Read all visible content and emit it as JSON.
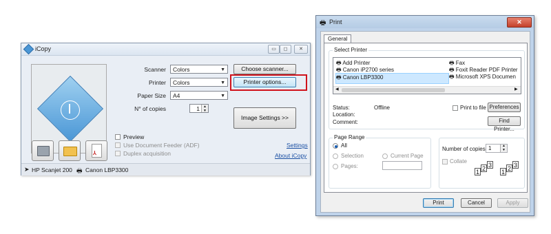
{
  "icopy": {
    "title": "iCopy",
    "window_buttons": {
      "minimize": "▭",
      "maximize": "◻",
      "close": "✕"
    },
    "scanner_label": "Scanner",
    "scanner_value": "Colors",
    "printer_label": "Printer",
    "printer_value": "Colors",
    "paper_size_label": "Paper Size",
    "paper_size_value": "A4",
    "copies_label": "N° of copies",
    "copies_value": "1",
    "choose_scanner_button": "Choose scanner...",
    "printer_options_button": "Printer options...",
    "image_settings_button": "Image Settings >>",
    "preview_label": "Preview",
    "adf_label": "Use Document Feeder (ADF)",
    "duplex_label": "Duplex acquisition",
    "settings_link": "Settings",
    "about_link": "About iCopy",
    "status_scanner": "HP Scanjet 200",
    "status_printer": "Canon LBP3300",
    "colors": {
      "highlight_red": "#d0121b",
      "accent_blue": "#4b97d6"
    }
  },
  "print": {
    "title": "Print",
    "tab": "General",
    "select_printer_title": "Select Printer",
    "printers_left": [
      "Add Printer",
      "Canon iP2700 series",
      "Canon LBP3300"
    ],
    "printers_right": [
      "Fax",
      "Foxit Reader PDF Printer",
      "Microsoft XPS Documen"
    ],
    "selected_printer": "Canon LBP3300",
    "status_label": "Status:",
    "status_value": "Offline",
    "location_label": "Location:",
    "comment_label": "Comment:",
    "print_to_file_label": "Print to file",
    "preferences_button": "Preferences",
    "find_printer_button": "Find Printer...",
    "page_range_title": "Page Range",
    "range_all": "All",
    "range_selection": "Selection",
    "range_current": "Current Page",
    "range_pages": "Pages:",
    "copies_label": "Number of copies:",
    "copies_value": "1",
    "collate_label": "Collate",
    "print_button": "Print",
    "cancel_button": "Cancel",
    "apply_button": "Apply"
  }
}
